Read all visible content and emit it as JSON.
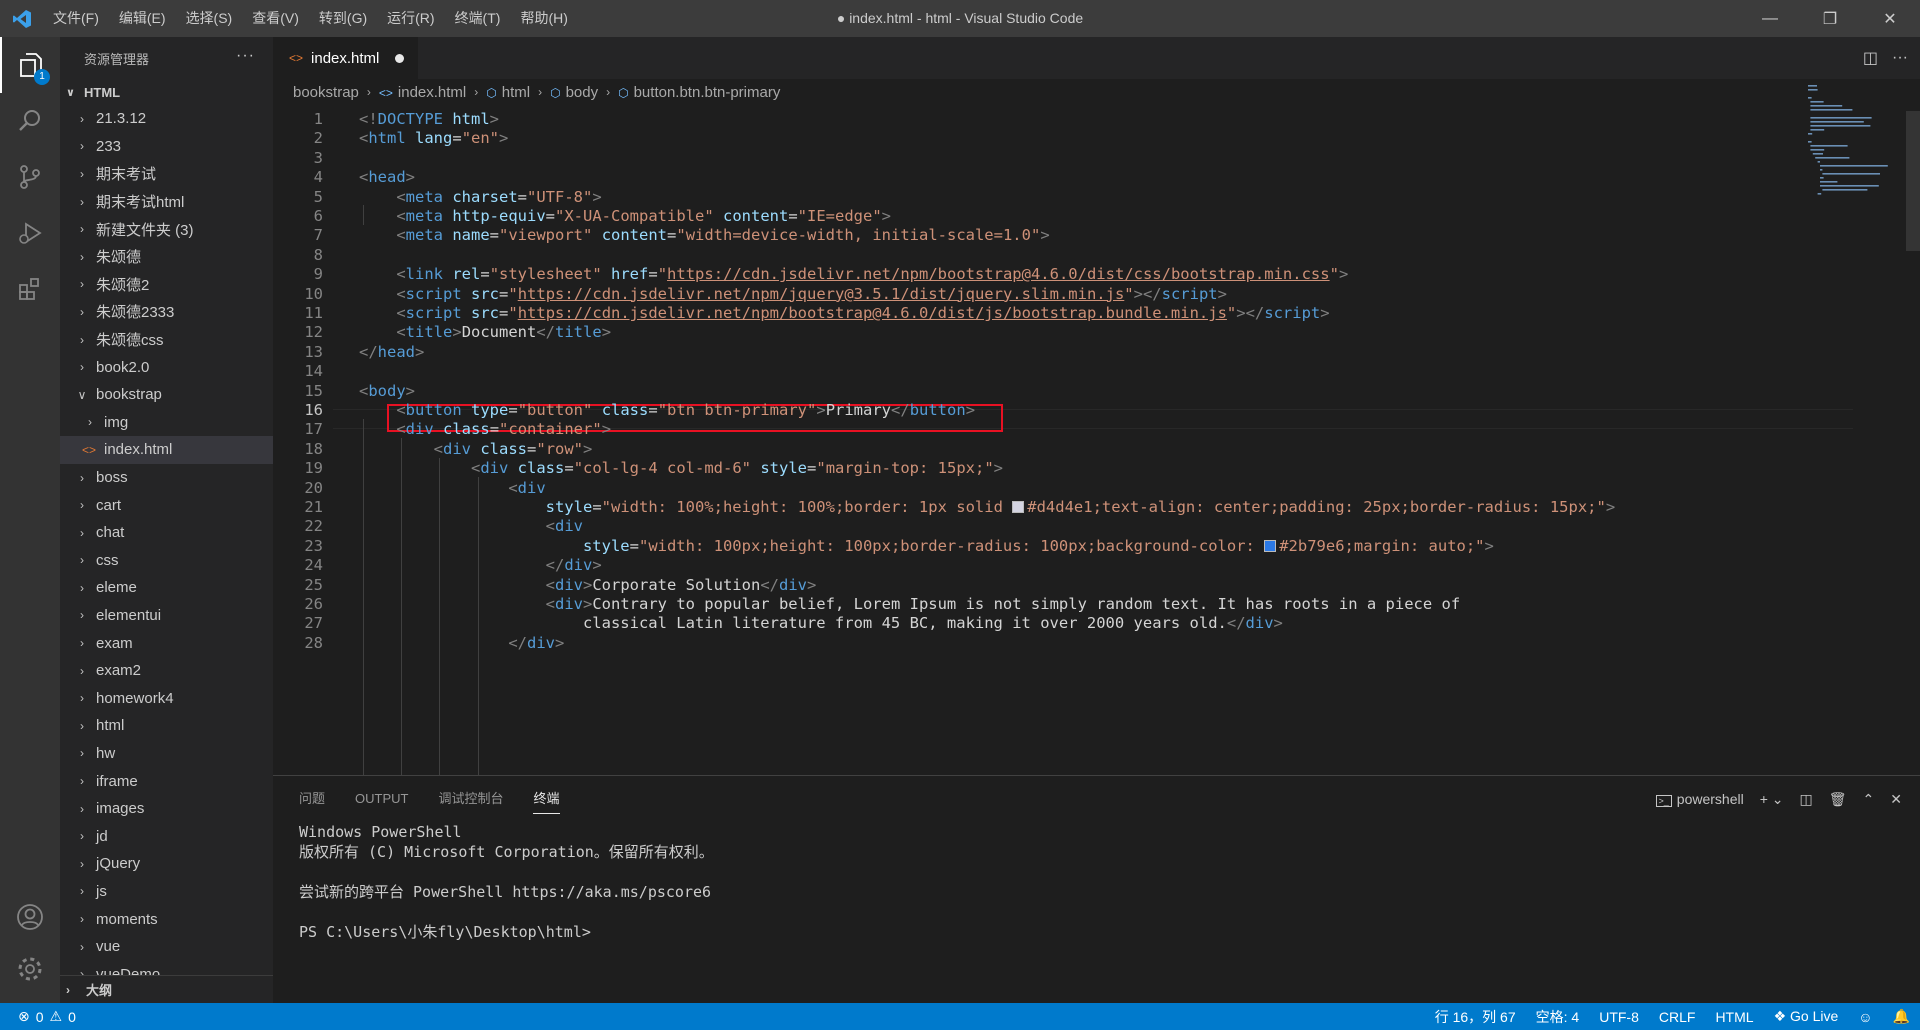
{
  "titlebar": {
    "menu": [
      "文件(F)",
      "编辑(E)",
      "选择(S)",
      "查看(V)",
      "转到(G)",
      "运行(R)",
      "终端(T)",
      "帮助(H)"
    ],
    "title": "● index.html - html - Visual Studio Code"
  },
  "activitybar": {
    "explorer_badge": "1"
  },
  "sidebar": {
    "header": "资源管理器",
    "more": "···",
    "section": "HTML",
    "items": [
      {
        "label": "21.3.12",
        "expanded": false,
        "depth": 0
      },
      {
        "label": "233",
        "expanded": false,
        "depth": 0
      },
      {
        "label": "期末考试",
        "expanded": false,
        "depth": 0
      },
      {
        "label": "期末考试html",
        "expanded": false,
        "depth": 0
      },
      {
        "label": "新建文件夹 (3)",
        "expanded": false,
        "depth": 0
      },
      {
        "label": "朱颂德",
        "expanded": false,
        "depth": 0
      },
      {
        "label": "朱颂德2",
        "expanded": false,
        "depth": 0
      },
      {
        "label": "朱颂德2333",
        "expanded": false,
        "depth": 0
      },
      {
        "label": "朱颂德css",
        "expanded": false,
        "depth": 0
      },
      {
        "label": "book2.0",
        "expanded": false,
        "depth": 0
      },
      {
        "label": "bookstrap",
        "expanded": true,
        "depth": 0
      },
      {
        "label": "img",
        "expanded": false,
        "depth": 1
      },
      {
        "label": "index.html",
        "file": true,
        "depth": 1,
        "selected": true
      },
      {
        "label": "boss",
        "expanded": false,
        "depth": 0
      },
      {
        "label": "cart",
        "expanded": false,
        "depth": 0
      },
      {
        "label": "chat",
        "expanded": false,
        "depth": 0
      },
      {
        "label": "css",
        "expanded": false,
        "depth": 0
      },
      {
        "label": "eleme",
        "expanded": false,
        "depth": 0
      },
      {
        "label": "elementui",
        "expanded": false,
        "depth": 0
      },
      {
        "label": "exam",
        "expanded": false,
        "depth": 0
      },
      {
        "label": "exam2",
        "expanded": false,
        "depth": 0
      },
      {
        "label": "homework4",
        "expanded": false,
        "depth": 0
      },
      {
        "label": "html",
        "expanded": false,
        "depth": 0
      },
      {
        "label": "hw",
        "expanded": false,
        "depth": 0
      },
      {
        "label": "iframe",
        "expanded": false,
        "depth": 0
      },
      {
        "label": "images",
        "expanded": false,
        "depth": 0
      },
      {
        "label": "jd",
        "expanded": false,
        "depth": 0
      },
      {
        "label": "jQuery",
        "expanded": false,
        "depth": 0
      },
      {
        "label": "js",
        "expanded": false,
        "depth": 0
      },
      {
        "label": "moments",
        "expanded": false,
        "depth": 0
      },
      {
        "label": "vue",
        "expanded": false,
        "depth": 0
      },
      {
        "label": "vueDemo",
        "expanded": false,
        "depth": 0
      }
    ],
    "outline": "大纲"
  },
  "editor": {
    "tab": "index.html",
    "breadcrumb": [
      "bookstrap",
      "index.html",
      "html",
      "body",
      "button.btn.btn-primary"
    ],
    "current_line": 16,
    "lines": [
      [
        [
          "br",
          "<!"
        ],
        [
          "tg",
          "DOCTYPE"
        ],
        [
          "tx",
          " "
        ],
        [
          "at",
          "html"
        ],
        [
          "br",
          ">"
        ]
      ],
      [
        [
          "br",
          "<"
        ],
        [
          "tg",
          "html"
        ],
        [
          "tx",
          " "
        ],
        [
          "at",
          "lang"
        ],
        [
          "tx",
          "="
        ],
        [
          "st",
          "\"en\""
        ],
        [
          "br",
          ">"
        ]
      ],
      [],
      [
        [
          "br",
          "<"
        ],
        [
          "tg",
          "head"
        ],
        [
          "br",
          ">"
        ]
      ],
      [
        [
          "tx",
          "    "
        ],
        [
          "br",
          "<"
        ],
        [
          "tg",
          "meta"
        ],
        [
          "tx",
          " "
        ],
        [
          "at",
          "charset"
        ],
        [
          "tx",
          "="
        ],
        [
          "st",
          "\"UTF-8\""
        ],
        [
          "br",
          ">"
        ]
      ],
      [
        [
          "tx",
          "    "
        ],
        [
          "br",
          "<"
        ],
        [
          "tg",
          "meta"
        ],
        [
          "tx",
          " "
        ],
        [
          "at",
          "http-equiv"
        ],
        [
          "tx",
          "="
        ],
        [
          "st",
          "\"X-UA-Compatible\""
        ],
        [
          "tx",
          " "
        ],
        [
          "at",
          "content"
        ],
        [
          "tx",
          "="
        ],
        [
          "st",
          "\"IE=edge\""
        ],
        [
          "br",
          ">"
        ]
      ],
      [
        [
          "tx",
          "    "
        ],
        [
          "br",
          "<"
        ],
        [
          "tg",
          "meta"
        ],
        [
          "tx",
          " "
        ],
        [
          "at",
          "name"
        ],
        [
          "tx",
          "="
        ],
        [
          "st",
          "\"viewport\""
        ],
        [
          "tx",
          " "
        ],
        [
          "at",
          "content"
        ],
        [
          "tx",
          "="
        ],
        [
          "st",
          "\"width=device-width, initial-scale=1.0\""
        ],
        [
          "br",
          ">"
        ]
      ],
      [],
      [
        [
          "tx",
          "    "
        ],
        [
          "br",
          "<"
        ],
        [
          "tg",
          "link"
        ],
        [
          "tx",
          " "
        ],
        [
          "at",
          "rel"
        ],
        [
          "tx",
          "="
        ],
        [
          "st",
          "\"stylesheet\""
        ],
        [
          "tx",
          " "
        ],
        [
          "at",
          "href"
        ],
        [
          "tx",
          "="
        ],
        [
          "st",
          "\""
        ],
        [
          "stu",
          "https://cdn.jsdelivr.net/npm/bootstrap@4.6.0/dist/css/bootstrap.min.css"
        ],
        [
          "st",
          "\""
        ],
        [
          "br",
          ">"
        ]
      ],
      [
        [
          "tx",
          "    "
        ],
        [
          "br",
          "<"
        ],
        [
          "tg",
          "script"
        ],
        [
          "tx",
          " "
        ],
        [
          "at",
          "src"
        ],
        [
          "tx",
          "="
        ],
        [
          "st",
          "\""
        ],
        [
          "stu",
          "https://cdn.jsdelivr.net/npm/jquery@3.5.1/dist/jquery.slim.min.js"
        ],
        [
          "st",
          "\""
        ],
        [
          "br",
          "></"
        ],
        [
          "tg",
          "script"
        ],
        [
          "br",
          ">"
        ]
      ],
      [
        [
          "tx",
          "    "
        ],
        [
          "br",
          "<"
        ],
        [
          "tg",
          "script"
        ],
        [
          "tx",
          " "
        ],
        [
          "at",
          "src"
        ],
        [
          "tx",
          "="
        ],
        [
          "st",
          "\""
        ],
        [
          "stu",
          "https://cdn.jsdelivr.net/npm/bootstrap@4.6.0/dist/js/bootstrap.bundle.min.js"
        ],
        [
          "st",
          "\""
        ],
        [
          "br",
          "></"
        ],
        [
          "tg",
          "script"
        ],
        [
          "br",
          ">"
        ]
      ],
      [
        [
          "tx",
          "    "
        ],
        [
          "br",
          "<"
        ],
        [
          "tg",
          "title"
        ],
        [
          "br",
          ">"
        ],
        [
          "tx",
          "Document"
        ],
        [
          "br",
          "</"
        ],
        [
          "tg",
          "title"
        ],
        [
          "br",
          ">"
        ]
      ],
      [
        [
          "br",
          "</"
        ],
        [
          "tg",
          "head"
        ],
        [
          "br",
          ">"
        ]
      ],
      [],
      [
        [
          "br",
          "<"
        ],
        [
          "tg",
          "body"
        ],
        [
          "br",
          ">"
        ]
      ],
      [
        [
          "tx",
          "    "
        ],
        [
          "br",
          "<"
        ],
        [
          "tg",
          "button"
        ],
        [
          "tx",
          " "
        ],
        [
          "at",
          "type"
        ],
        [
          "tx",
          "="
        ],
        [
          "st",
          "\"button\""
        ],
        [
          "tx",
          " "
        ],
        [
          "at",
          "class"
        ],
        [
          "tx",
          "="
        ],
        [
          "st",
          "\"btn btn-primary\""
        ],
        [
          "br",
          ">"
        ],
        [
          "tx",
          "Primary"
        ],
        [
          "br",
          "</"
        ],
        [
          "tg",
          "button"
        ],
        [
          "br",
          ">"
        ]
      ],
      [
        [
          "tx",
          "    "
        ],
        [
          "br",
          "<"
        ],
        [
          "tg",
          "div"
        ],
        [
          "tx",
          " "
        ],
        [
          "at",
          "class"
        ],
        [
          "tx",
          "="
        ],
        [
          "st",
          "\"container\""
        ],
        [
          "br",
          ">"
        ]
      ],
      [
        [
          "tx",
          "        "
        ],
        [
          "br",
          "<"
        ],
        [
          "tg",
          "div"
        ],
        [
          "tx",
          " "
        ],
        [
          "at",
          "class"
        ],
        [
          "tx",
          "="
        ],
        [
          "st",
          "\"row\""
        ],
        [
          "br",
          ">"
        ]
      ],
      [
        [
          "tx",
          "            "
        ],
        [
          "br",
          "<"
        ],
        [
          "tg",
          "div"
        ],
        [
          "tx",
          " "
        ],
        [
          "at",
          "class"
        ],
        [
          "tx",
          "="
        ],
        [
          "st",
          "\"col-lg-4 col-md-6\""
        ],
        [
          "tx",
          " "
        ],
        [
          "at",
          "style"
        ],
        [
          "tx",
          "="
        ],
        [
          "st",
          "\"margin-top: 15px;\""
        ],
        [
          "br",
          ">"
        ]
      ],
      [
        [
          "tx",
          "                "
        ],
        [
          "br",
          "<"
        ],
        [
          "tg",
          "div"
        ]
      ],
      [
        [
          "tx",
          "                    "
        ],
        [
          "at",
          "style"
        ],
        [
          "tx",
          "="
        ],
        [
          "st",
          "\"width: 100%;height: 100%;border: 1px solid "
        ],
        [
          "sw",
          "#d4d4e1"
        ],
        [
          "st",
          "#d4d4e1;text-align: center;padding: 25px;border-radius: 15px;\""
        ],
        [
          "br",
          ">"
        ]
      ],
      [
        [
          "tx",
          "                    "
        ],
        [
          "br",
          "<"
        ],
        [
          "tg",
          "div"
        ]
      ],
      [
        [
          "tx",
          "                        "
        ],
        [
          "at",
          "style"
        ],
        [
          "tx",
          "="
        ],
        [
          "st",
          "\"width: 100px;height: 100px;border-radius: 100px;background-color: "
        ],
        [
          "sw",
          "#2b79e6"
        ],
        [
          "st",
          "#2b79e6;margin: auto;\""
        ],
        [
          "br",
          ">"
        ]
      ],
      [
        [
          "tx",
          "                    "
        ],
        [
          "br",
          "</"
        ],
        [
          "tg",
          "div"
        ],
        [
          "br",
          ">"
        ]
      ],
      [
        [
          "tx",
          "                    "
        ],
        [
          "br",
          "<"
        ],
        [
          "tg",
          "div"
        ],
        [
          "br",
          ">"
        ],
        [
          "tx",
          "Corporate Solution"
        ],
        [
          "br",
          "</"
        ],
        [
          "tg",
          "div"
        ],
        [
          "br",
          ">"
        ]
      ],
      [
        [
          "tx",
          "                    "
        ],
        [
          "br",
          "<"
        ],
        [
          "tg",
          "div"
        ],
        [
          "br",
          ">"
        ],
        [
          "tx",
          "Contrary to popular belief, Lorem Ipsum is not simply random text. It has roots in a piece of"
        ]
      ],
      [
        [
          "tx",
          "                        classical Latin literature from 45 BC, making it over 2000 years old."
        ],
        [
          "br",
          "</"
        ],
        [
          "tg",
          "div"
        ],
        [
          "br",
          ">"
        ]
      ],
      [
        [
          "tx",
          "                "
        ],
        [
          "br",
          "</"
        ],
        [
          "tg",
          "div"
        ],
        [
          "br",
          ">"
        ]
      ]
    ]
  },
  "panel": {
    "tabs": [
      "问题",
      "OUTPUT",
      "调试控制台",
      "终端"
    ],
    "active_tab": "终端",
    "shell": "powershell",
    "terminal": "Windows PowerShell\n版权所有 (C) Microsoft Corporation。保留所有权利。\n\n尝试新的跨平台 PowerShell https://aka.ms/pscore6\n\nPS C:\\Users\\小朱fly\\Desktop\\html>"
  },
  "statusbar": {
    "errors": "0",
    "warnings": "0",
    "position": "行 16，列 67",
    "spaces": "空格: 4",
    "encoding": "UTF-8",
    "eol": "CRLF",
    "language": "HTML",
    "golive": "Go Live"
  }
}
